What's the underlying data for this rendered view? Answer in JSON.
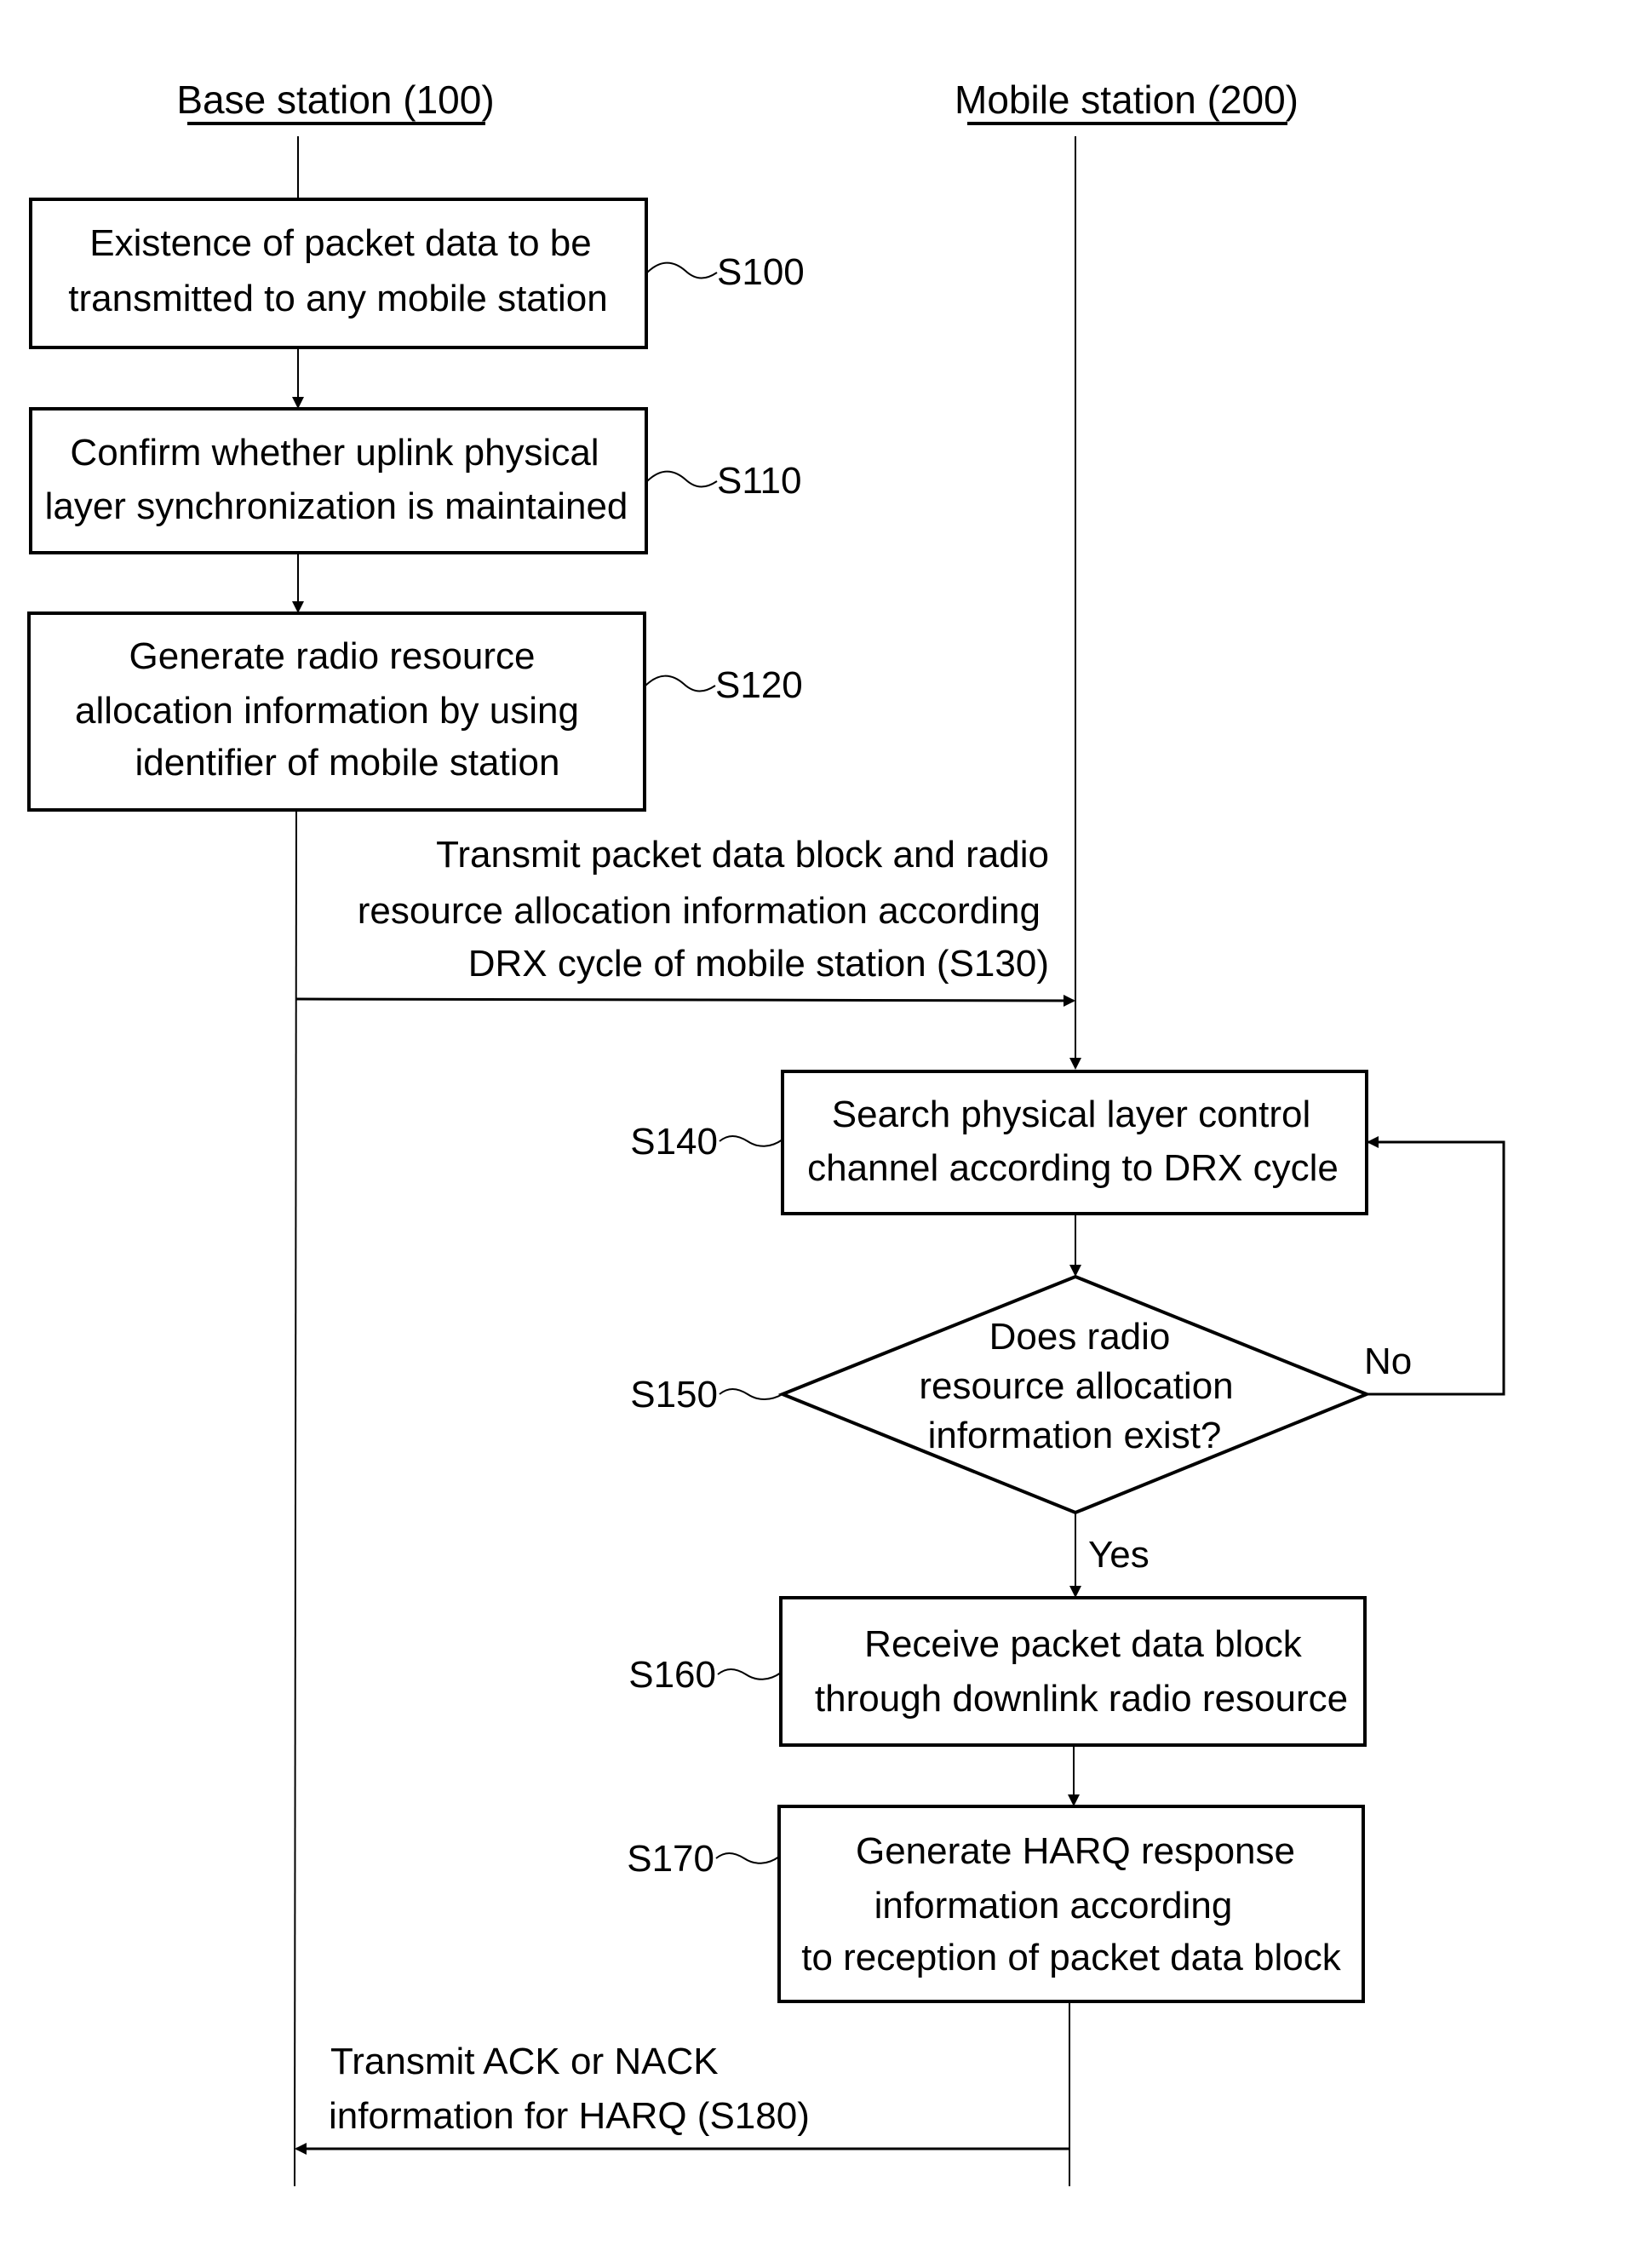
{
  "headers": {
    "base": "Base station (100)",
    "mobile": "Mobile station (200)"
  },
  "steps": {
    "s100": {
      "id": "S100",
      "lines": [
        "Existence of packet data to be",
        "transmitted to any mobile station"
      ]
    },
    "s110": {
      "id": "S110",
      "lines": [
        "Confirm whether uplink physical",
        "layer synchronization is maintained"
      ]
    },
    "s120": {
      "id": "S120",
      "lines": [
        "Generate radio resource",
        "allocation information by using",
        "identifier of mobile station"
      ]
    },
    "s130": {
      "lines": [
        "Transmit packet data block and radio",
        "resource allocation information according",
        "DRX cycle of mobile station  (S130)"
      ]
    },
    "s140": {
      "id": "S140",
      "lines": [
        "Search physical layer control",
        "channel according to DRX cycle"
      ]
    },
    "s150": {
      "id": "S150",
      "lines": [
        "Does radio",
        "resource allocation",
        "information exist?"
      ],
      "no_label": "No",
      "yes_label": "Yes"
    },
    "s160": {
      "id": "S160",
      "lines": [
        "Receive packet data block",
        "through downlink radio resource"
      ]
    },
    "s170": {
      "id": "S170",
      "lines": [
        "Generate HARQ response",
        "information according",
        "to reception of packet data block"
      ]
    },
    "s180": {
      "lines": [
        "Transmit ACK or NACK",
        "information for HARQ  (S180)"
      ]
    }
  }
}
